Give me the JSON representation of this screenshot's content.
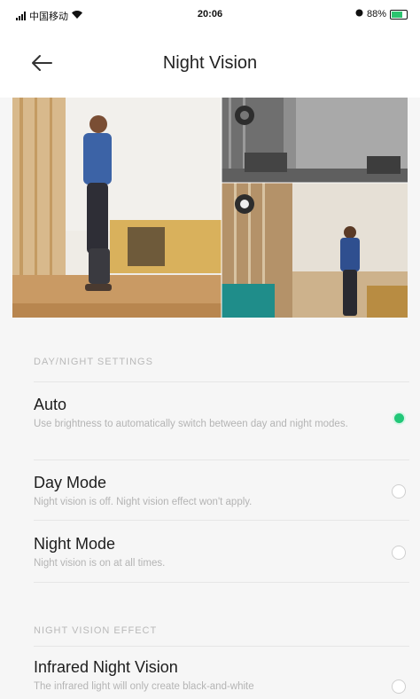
{
  "status_bar": {
    "carrier": "中国移动",
    "time": "20:06",
    "battery": "88%"
  },
  "header": {
    "title": "Night Vision",
    "back_icon": "arrow-left-icon"
  },
  "sections": [
    {
      "header": "DAY/NIGHT SETTINGS",
      "options": [
        {
          "title": "Auto",
          "description": "Use brightness to automatically switch between day and night modes.",
          "selected": true
        },
        {
          "title": "Day Mode",
          "description": "Night vision is off. Night vision effect won't apply.",
          "selected": false
        },
        {
          "title": "Night Mode",
          "description": "Night vision is on at all times.",
          "selected": false
        }
      ]
    },
    {
      "header": "NIGHT VISION EFFECT",
      "options": [
        {
          "title": "Infrared Night Vision",
          "description": "The infrared light will only create black-and-white",
          "selected": false
        }
      ]
    }
  ],
  "colors": {
    "accent": "#22c778",
    "section_header": "#b9b9b9",
    "description": "#b4b4b4"
  }
}
